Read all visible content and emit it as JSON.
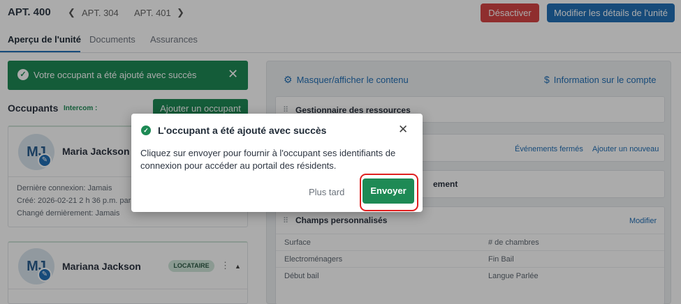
{
  "header": {
    "title": "APT. 400",
    "prev_unit": "APT. 304",
    "next_unit": "APT. 401",
    "deactivate_label": "Désactiver",
    "edit_label": "Modifier les détails de l'unité"
  },
  "tabs": [
    {
      "label": "Aperçu de l'unité",
      "active": true
    },
    {
      "label": "Documents",
      "active": false
    },
    {
      "label": "Assurances",
      "active": false
    }
  ],
  "toast": {
    "message": "Votre occupant a été ajouté avec succès"
  },
  "occupants": {
    "title": "Occupants",
    "intercom_label": "Intercom :",
    "add_label": "Ajouter un occupant",
    "cards": [
      {
        "initials": "MJ",
        "name": "Maria Jackson",
        "last_login": "Dernière connexion:  Jamais",
        "created": "Créé:  2026-02-21 2 h 36 p.m. par J",
        "changed": "Changé dernièrement:  Jamais"
      },
      {
        "initials": "MJ",
        "name": "Mariana Jackson",
        "badge": "LOCATAIRE"
      }
    ]
  },
  "right_panel": {
    "toggle_label": "Masquer/afficher le contenu",
    "account_label": "Information sur le compte",
    "resources_title": "Gestionnaire des ressources",
    "events_closed": "Événements fermés",
    "events_add": "Ajouter un nouveau",
    "partial_title": "ement",
    "custom_fields_title": "Champs personnalisés",
    "edit_link": "Modifier",
    "fields": [
      {
        "left": "Surface",
        "right": "# de chambres"
      },
      {
        "left": "Electroménagers",
        "right": "Fin Bail"
      },
      {
        "left": "Début bail",
        "right": "Langue Parlée"
      }
    ]
  },
  "modal": {
    "title": "L'occupant a été ajouté avec succès",
    "body": "Cliquez sur envoyer pour fournir à l'occupant ses identifiants de connexion pour accéder au portail des résidents.",
    "later_label": "Plus tard",
    "send_label": "Envoyer"
  },
  "colors": {
    "primary_blue": "#2370b6",
    "success_green": "#1e8a55",
    "danger_red": "#d64545",
    "highlight_ring": "#e02020"
  }
}
